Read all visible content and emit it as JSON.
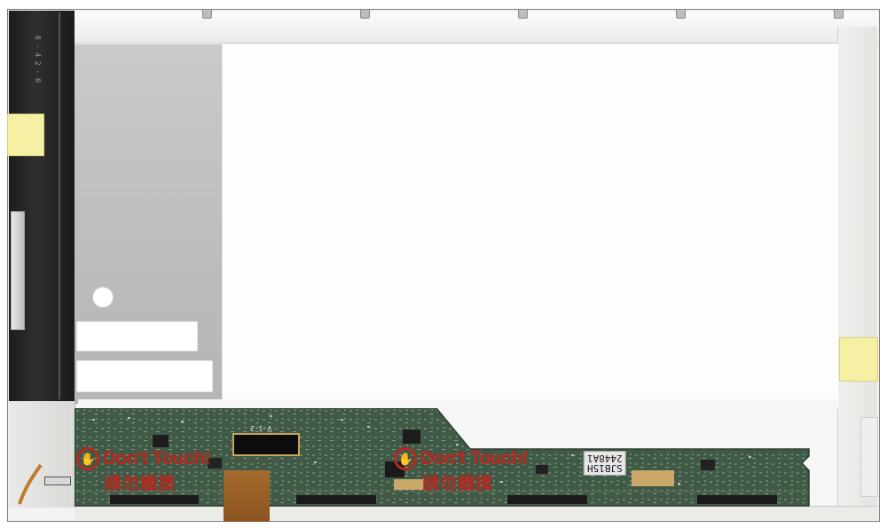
{
  "image": {
    "subject": "Laptop LCD panel, rear view"
  },
  "warnings": [
    {
      "text_en": "Don't Touch!",
      "text_cjk": "請勿觸摸"
    },
    {
      "text_en": "Don't Touch!",
      "text_cjk": "請勿觸摸"
    }
  ],
  "pcb": {
    "connector_label": "V-1-2",
    "model_code": "SJB15H\n2448A1"
  },
  "left_ticks": "8 · 4 2 · 0",
  "colors": {
    "pcb_green": "#3f5a46",
    "warning_red": "#b32a22",
    "tape_yellow": "#f6f0a4",
    "metal_grey": "#c2c2c2"
  }
}
